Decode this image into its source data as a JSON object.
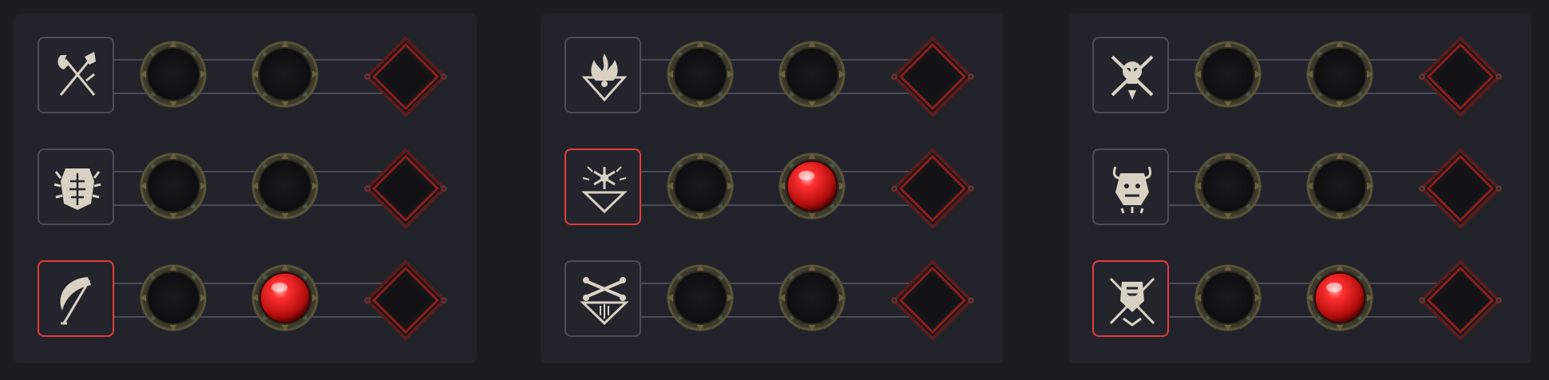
{
  "colors": {
    "background": "#1b1c20",
    "panel": "#22232a",
    "node_active_border": "#e23b3b",
    "node_border": "#4b4c57",
    "gem": "#e01818",
    "icon": "#d9d1c3"
  },
  "columns": [
    {
      "rows": [
        {
          "icon": "axe-and-sword-icon",
          "selected": false,
          "filled_socket": null
        },
        {
          "icon": "spiked-armor-icon",
          "selected": false,
          "filled_socket": null
        },
        {
          "icon": "scythe-icon",
          "selected": true,
          "filled_socket": 2
        }
      ]
    },
    {
      "rows": [
        {
          "icon": "flame-sigil-icon",
          "selected": false,
          "filled_socket": null
        },
        {
          "icon": "frost-sigil-icon",
          "selected": true,
          "filled_socket": 2
        },
        {
          "icon": "bone-sigil-icon",
          "selected": false,
          "filled_socket": null
        }
      ]
    },
    {
      "rows": [
        {
          "icon": "skull-and-bones-icon",
          "selected": false,
          "filled_socket": null
        },
        {
          "icon": "demon-totem-icon",
          "selected": false,
          "filled_socket": null
        },
        {
          "icon": "shield-and-swords-icon",
          "selected": true,
          "filled_socket": 2
        }
      ]
    }
  ]
}
